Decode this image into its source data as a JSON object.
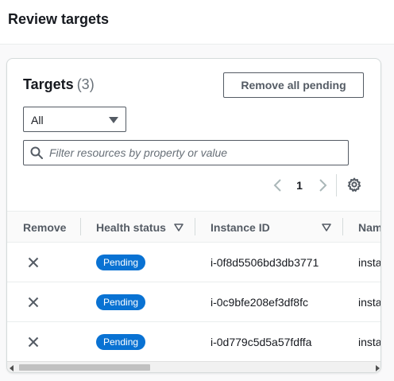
{
  "page": {
    "title": "Review targets"
  },
  "targets": {
    "title": "Targets",
    "count": "(3)",
    "remove_all_label": "Remove all pending",
    "filter_select": {
      "value": "All"
    },
    "search": {
      "placeholder": "Filter resources by property or value",
      "value": ""
    },
    "pagination": {
      "current_page": "1"
    },
    "columns": {
      "remove": "Remove",
      "health": "Health status",
      "instance_id": "Instance ID",
      "name": "Nam"
    },
    "rows": [
      {
        "health": "Pending",
        "instance_id": "i-0f8d5506bd3db3771",
        "name": "insta"
      },
      {
        "health": "Pending",
        "instance_id": "i-0c9bfe208ef3df8fc",
        "name": "insta"
      },
      {
        "health": "Pending",
        "instance_id": "i-0d779c5d5a57fdffa",
        "name": "insta"
      }
    ]
  },
  "colors": {
    "accent": "#0972d3",
    "text": "#16191f",
    "muted": "#687078",
    "border": "#545b64"
  },
  "icons": {
    "search": "search-icon",
    "caret": "caret-down-icon",
    "prev": "chevron-left-icon",
    "next": "chevron-right-icon",
    "settings": "gear-icon",
    "sort": "sort-down-icon",
    "remove": "close-icon"
  }
}
